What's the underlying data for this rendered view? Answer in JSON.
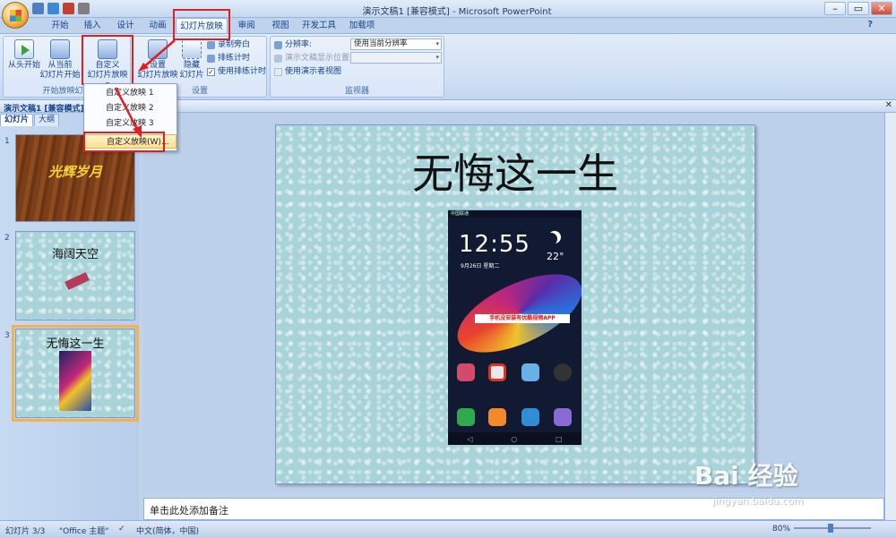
{
  "window": {
    "title": "演示文稿1 [兼容模式] - Microsoft PowerPoint"
  },
  "tabs": [
    "开始",
    "插入",
    "设计",
    "动画",
    "幻灯片放映",
    "审阅",
    "视图",
    "开发工具",
    "加载项"
  ],
  "active_tab": "幻灯片放映",
  "ribbon": {
    "group1": {
      "label": "开始放映幻灯",
      "from_beginning": "从头开始",
      "from_current_1": "从当前",
      "from_current_2": "幻灯片开始",
      "custom_1": "自定义",
      "custom_2": "幻灯片放映 ▾"
    },
    "group2": {
      "label": "设置",
      "setup_1": "设置",
      "setup_2": "幻灯片放映",
      "hide_1": "隐藏",
      "hide_2": "幻灯片",
      "record": "录制旁白",
      "rehearse": "排练计时",
      "use_timings": "使用排练计时",
      "use_timings_checked": true
    },
    "group3": {
      "label": "监视器",
      "resolution_label": "分辨率:",
      "resolution_value": "使用当前分辨率",
      "show_on_label": "演示文稿显示位置:",
      "presenter_view": "使用演示者视图"
    }
  },
  "dropdown": {
    "items": [
      "自定义放映 1",
      "自定义放映 2",
      "自定义放映 3",
      "自定义放映(W)..."
    ]
  },
  "doc_tab": "演示文稿1 [兼容模式]",
  "pane_tabs": [
    "幻灯片",
    "大纲"
  ],
  "slides": [
    {
      "num": "1",
      "title": "光辉岁月"
    },
    {
      "num": "2",
      "title": "海阔天空"
    },
    {
      "num": "3",
      "title": "无悔这一生"
    }
  ],
  "current_slide": {
    "title": "无悔这一生",
    "phone": {
      "time": "12:55",
      "date": "9月26日 星期二",
      "temp": "22°",
      "ad": "手机没安装有优酷视频APP",
      "status": "中国联通"
    }
  },
  "notes_placeholder": "单击此处添加备注",
  "statusbar": {
    "slide": "幻灯片 3/3",
    "theme": "\"Office 主题\"",
    "lang": "中文(简体，中国)",
    "zoom": "80%"
  },
  "watermark": {
    "brand": "Bai 经验",
    "url": "jingyan.baidu.com"
  },
  "colors": {
    "highlight_box": "#e02020",
    "selected_thumb": "#f7b04a"
  }
}
